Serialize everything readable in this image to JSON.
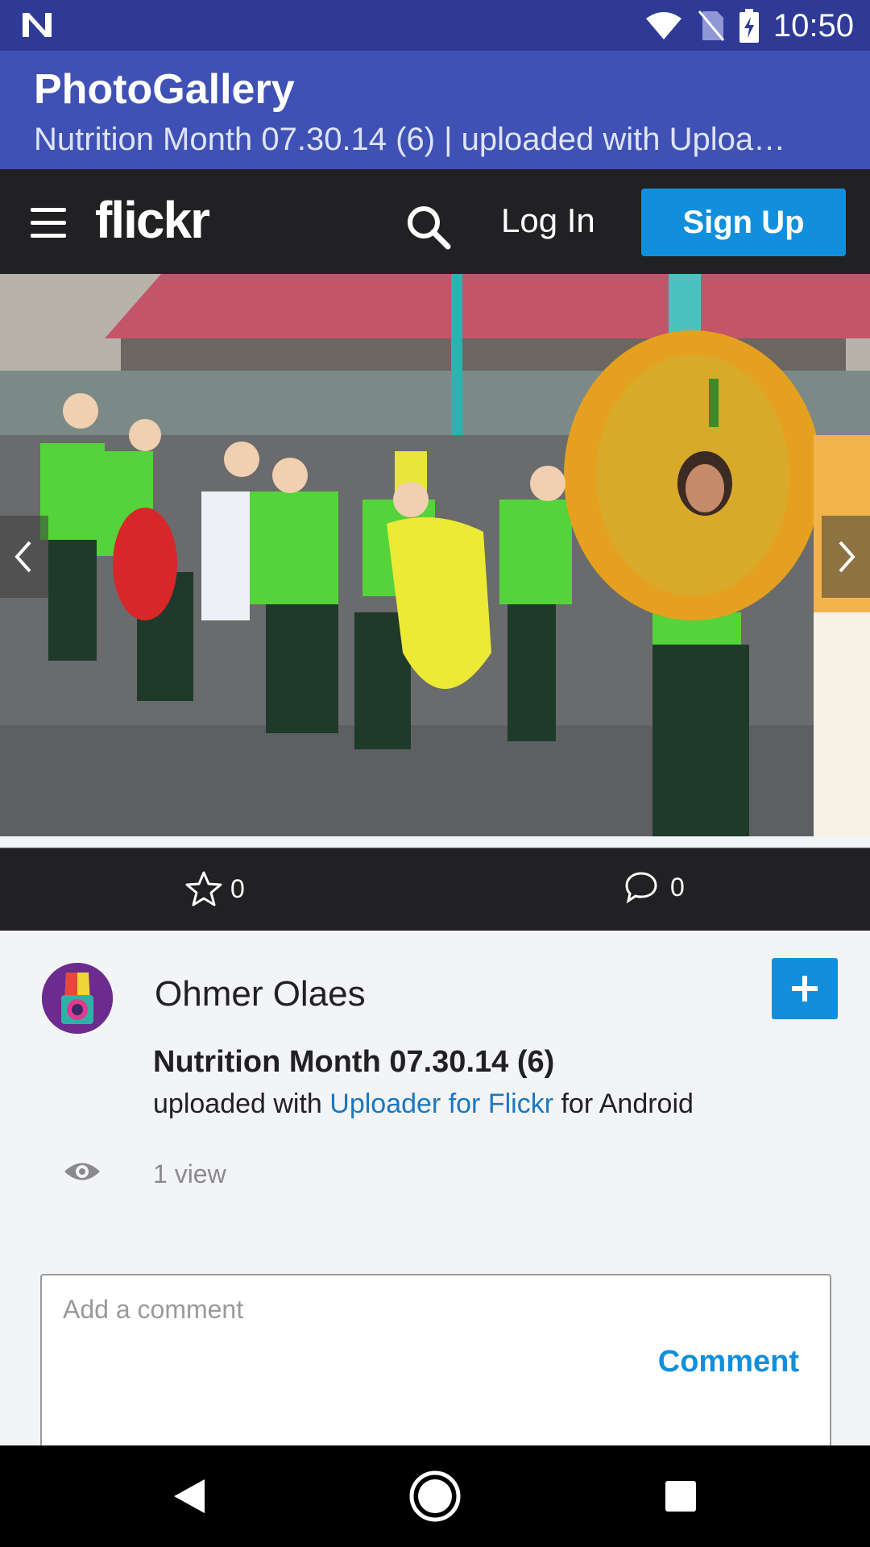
{
  "status_bar": {
    "time": "10:50",
    "icons": [
      "notification-n-icon",
      "wifi-icon",
      "no-sim-icon",
      "battery-charging-icon"
    ]
  },
  "app_bar": {
    "title": "PhotoGallery",
    "subtitle": "Nutrition Month 07.30.14 (6) | uploaded with Uploa…"
  },
  "flickr_nav": {
    "logo": "flickr",
    "login_label": "Log In",
    "signup_label": "Sign Up"
  },
  "photo_stats": {
    "favorites_count": "0",
    "comments_count": "0"
  },
  "photo_info": {
    "owner_name": "Ohmer Olaes",
    "title": "Nutrition Month 07.30.14 (6)",
    "desc_prefix": "uploaded with ",
    "desc_link": "Uploader for Flickr",
    "desc_suffix": " for Android",
    "views": "1 view"
  },
  "comment": {
    "placeholder": "Add a comment",
    "submit_label": "Comment"
  },
  "colors": {
    "status_bar": "#2f3a96",
    "app_bar": "#3f51b5",
    "flickr_dark": "#212124",
    "flickr_blue": "#128fdc",
    "link_blue": "#1a78c2"
  }
}
